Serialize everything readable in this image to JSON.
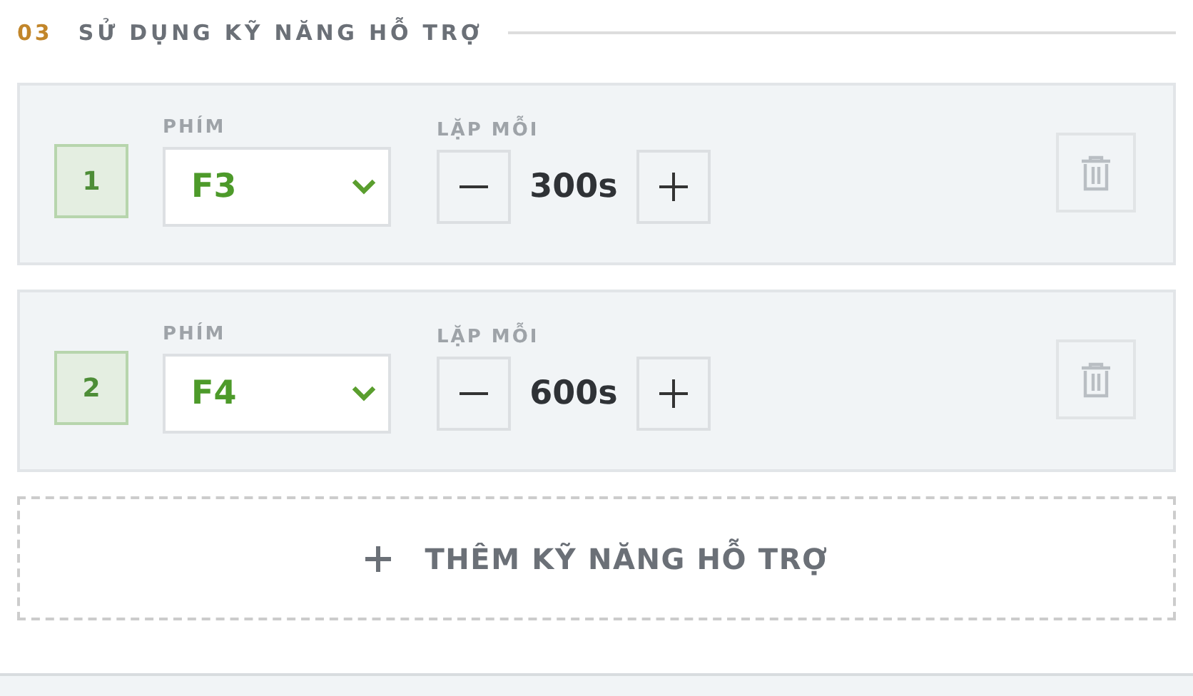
{
  "section": {
    "number": "03",
    "title": "SỬ DỤNG KỸ NĂNG HỖ TRỢ"
  },
  "skills": [
    {
      "index": "1",
      "key_label": "PHÍM",
      "key": "F3",
      "interval_label": "LẶP MỖI",
      "interval": "300s"
    },
    {
      "index": "2",
      "key_label": "PHÍM",
      "key": "F4",
      "interval_label": "LẶP MỖI",
      "interval": "600s"
    }
  ],
  "add_button": {
    "label": "THÊM KỸ NĂNG HỖ TRỢ"
  }
}
